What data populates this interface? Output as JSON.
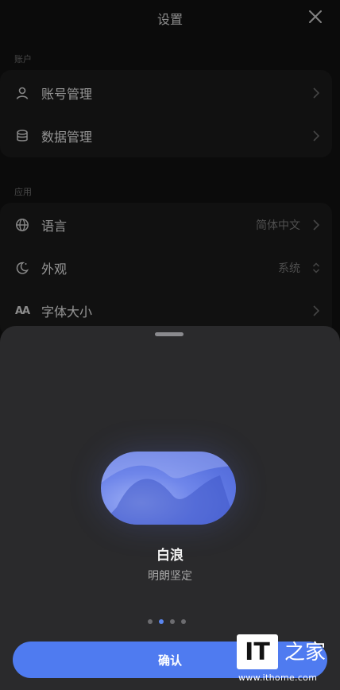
{
  "header": {
    "title": "设置",
    "close_icon": "close-icon"
  },
  "sections": {
    "account": {
      "label": "账户",
      "items": [
        {
          "label": "账号管理",
          "icon": "user-icon"
        },
        {
          "label": "数据管理",
          "icon": "database-icon"
        }
      ]
    },
    "app": {
      "label": "应用",
      "items": [
        {
          "label": "语言",
          "value": "简体中文",
          "icon": "globe-icon"
        },
        {
          "label": "外观",
          "value": "系统",
          "icon": "appearance-icon"
        },
        {
          "label": "字体大小",
          "value": "",
          "icon": "font-size-icon",
          "icon_text": "AA"
        }
      ]
    }
  },
  "sheet": {
    "theme_name": "白浪",
    "theme_desc": "明朗坚定",
    "page_count": 4,
    "active_page": 1,
    "confirm_label": "确认",
    "accent": "#4f7bf0"
  },
  "watermark": {
    "logo": "IT",
    "glyph": "之家",
    "url": "www.ithome.com"
  }
}
